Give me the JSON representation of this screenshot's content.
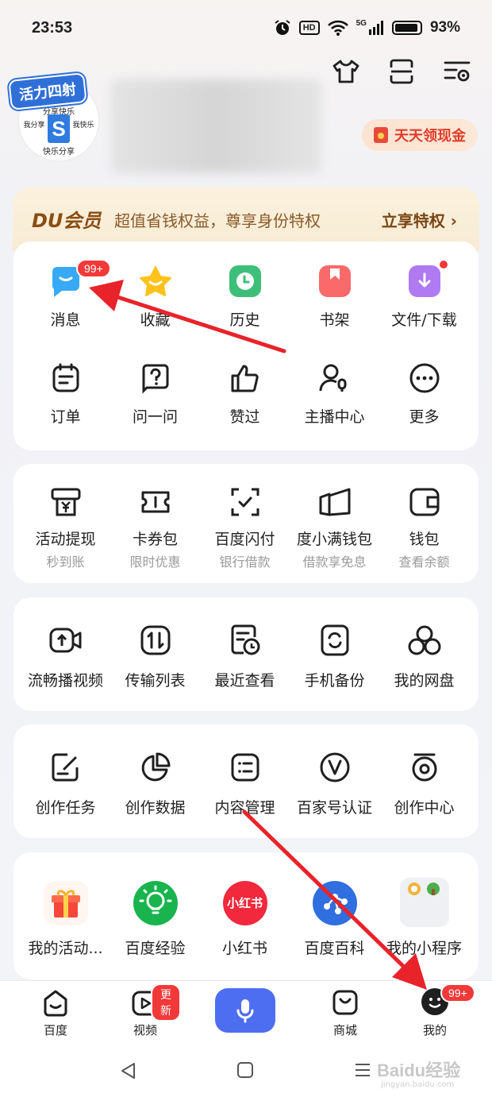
{
  "status_bar": {
    "time": "23:53",
    "network": "5G",
    "battery": "93%",
    "hd": "HD"
  },
  "profile": {
    "badge": "活力四射",
    "avatar_lines": [
      "分享快乐",
      "我分享",
      "我快乐",
      "快乐分享"
    ],
    "cash_label": "天天领现金"
  },
  "vip": {
    "title": "DU会员",
    "desc": "超值省钱权益，尊享身份特权",
    "link": "立享特权 ›"
  },
  "quick": [
    {
      "label": "消息",
      "badge": "99+"
    },
    {
      "label": "收藏"
    },
    {
      "label": "历史"
    },
    {
      "label": "书架"
    },
    {
      "label": "文件/下载"
    }
  ],
  "tools": [
    {
      "label": "订单"
    },
    {
      "label": "问一问"
    },
    {
      "label": "赞过"
    },
    {
      "label": "主播中心"
    },
    {
      "label": "更多"
    }
  ],
  "wallet": [
    {
      "label": "活动提现",
      "sub": "秒到账"
    },
    {
      "label": "卡券包",
      "sub": "限时优惠"
    },
    {
      "label": "百度闪付",
      "sub": "银行借款"
    },
    {
      "label": "度小满钱包",
      "sub": "借款享免息"
    },
    {
      "label": "钱包",
      "sub": "查看余额"
    }
  ],
  "disk": [
    {
      "label": "流畅播视频"
    },
    {
      "label": "传输列表"
    },
    {
      "label": "最近查看"
    },
    {
      "label": "手机备份"
    },
    {
      "label": "我的网盘"
    }
  ],
  "create": [
    {
      "label": "创作任务"
    },
    {
      "label": "创作数据"
    },
    {
      "label": "内容管理"
    },
    {
      "label": "百家号认证"
    },
    {
      "label": "创作中心"
    }
  ],
  "apps": [
    {
      "label": "我的活动..."
    },
    {
      "label": "百度经验"
    },
    {
      "label": "小红书",
      "icon_text": "小红书"
    },
    {
      "label": "百度百科"
    },
    {
      "label": "我的小程序"
    }
  ],
  "nav": {
    "home": "百度",
    "video": "视频",
    "video_badge": "更新",
    "mall": "商城",
    "mine": "我的",
    "mine_badge": "99+"
  },
  "watermark": {
    "text": "Baidu经验",
    "url": "jingyan.baidu.com"
  },
  "colors": {
    "accent_blue": "#4e6ef2",
    "badge_red": "#f2393a",
    "arrow_red": "#e8232a",
    "vip_brown": "#8a4d12"
  }
}
